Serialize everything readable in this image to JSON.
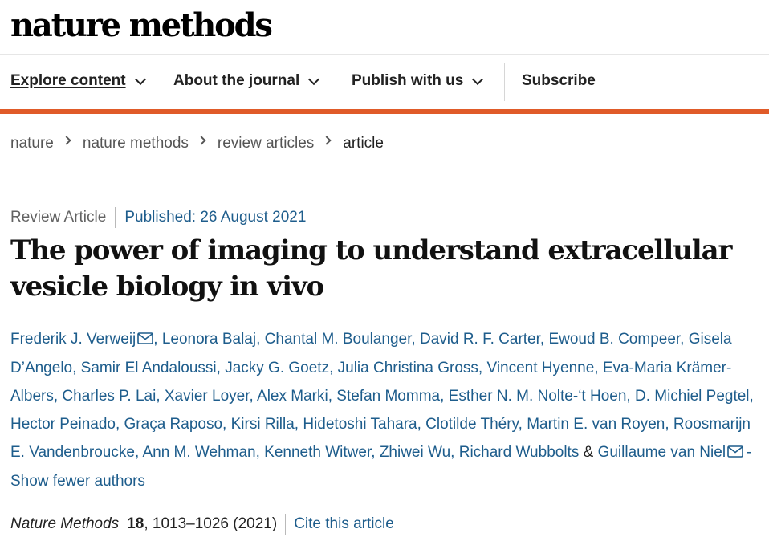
{
  "brand": {
    "logo_text": "nature methods",
    "accent_color": "#e05b29",
    "link_color": "#1e5d8c"
  },
  "nav": {
    "items": [
      {
        "label": "Explore content",
        "has_dropdown": true,
        "active": true
      },
      {
        "label": "About the journal",
        "has_dropdown": true,
        "active": false
      },
      {
        "label": "Publish with us",
        "has_dropdown": true,
        "active": false
      }
    ],
    "subscribe_label": "Subscribe"
  },
  "breadcrumb": [
    "nature",
    "nature methods",
    "review articles",
    "article"
  ],
  "article": {
    "type": "Review Article",
    "published": "Published: 26 August 2021",
    "title": "The power of imaging to understand extracellular vesicle biology in vivo",
    "authors": [
      "Frederik J. Verweij",
      "Leonora Balaj",
      "Chantal M. Boulanger",
      "David R. F. Carter",
      "Ewoud B. Compeer",
      "Gisela D’Angelo",
      "Samir El Andaloussi",
      "Jacky G. Goetz",
      "Julia Christina Gross",
      "Vincent Hyenne",
      "Eva-Maria Krämer-Albers",
      "Charles P. Lai",
      "Xavier Loyer",
      "Alex Marki",
      "Stefan Momma",
      "Esther N. M. Nolte-‘t Hoen",
      "D. Michiel Pegtel",
      "Hector Peinado",
      "Graça Raposo",
      "Kirsi Rilla",
      "Hidetoshi Tahara",
      "Clotilde Théry",
      "Martin E. van Royen",
      "Roosmarijn E. Vandenbroucke",
      "Ann M. Wehman",
      "Kenneth Witwer",
      "Zhiwei Wu",
      "Richard Wubbolts",
      "Guillaume van Niel"
    ],
    "ampersand": "&",
    "toggle_authors_label": "-Show fewer authors",
    "citation": {
      "journal": "Nature Methods",
      "volume": "18",
      "pages_year": ", 1013–1026 (2021)",
      "cite_label": "Cite this article"
    }
  }
}
